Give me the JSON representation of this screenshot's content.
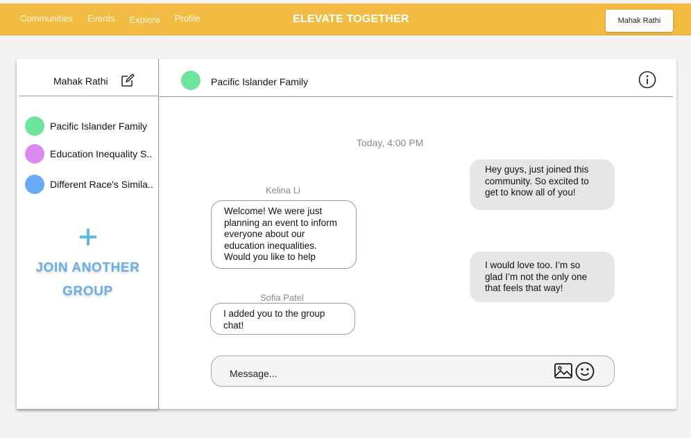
{
  "nav": {
    "links": [
      "Communities",
      "Events",
      "Explore",
      "Profile"
    ],
    "brand": "ELEVATE TOGETHER",
    "user_button": "Mahak Rathi"
  },
  "sidebar": {
    "user_name": "Mahak Rathi",
    "groups": [
      {
        "label": "Pacific Islander Family",
        "color": "#6ee39b"
      },
      {
        "label": "Education Inequality S..",
        "color": "#d98af0"
      },
      {
        "label": "Different Race's Simila..",
        "color": "#6aa9f5"
      }
    ],
    "join_line1": "JOIN ANOTHER",
    "join_line2": "GROUP"
  },
  "chat": {
    "title": "Pacific Islander Family",
    "timestamp": "Today, 4:00 PM",
    "messages": [
      {
        "direction": "out",
        "text": "Hey guys, just joined this community. So excited to get to know all of you!"
      },
      {
        "direction": "in",
        "sender": "Kelina Li",
        "text": "Welcome! We were just planning an event to inform everyone about our education inequalities. Would you like to help"
      },
      {
        "direction": "out",
        "text": "I would love too. I’m so glad I’m not the only one that feels that way!"
      },
      {
        "direction": "in",
        "sender": "Sofia Patel",
        "text": "I added you to the group chat!"
      }
    ],
    "composer_placeholder": "Message..."
  },
  "icons": {
    "edit": "edit-icon",
    "info": "info-icon",
    "image": "image-icon",
    "emoji": "emoji-icon",
    "plus": "plus-icon"
  },
  "colors": {
    "topbar": "#f2bc42",
    "accent_blue": "#6aaee8"
  }
}
